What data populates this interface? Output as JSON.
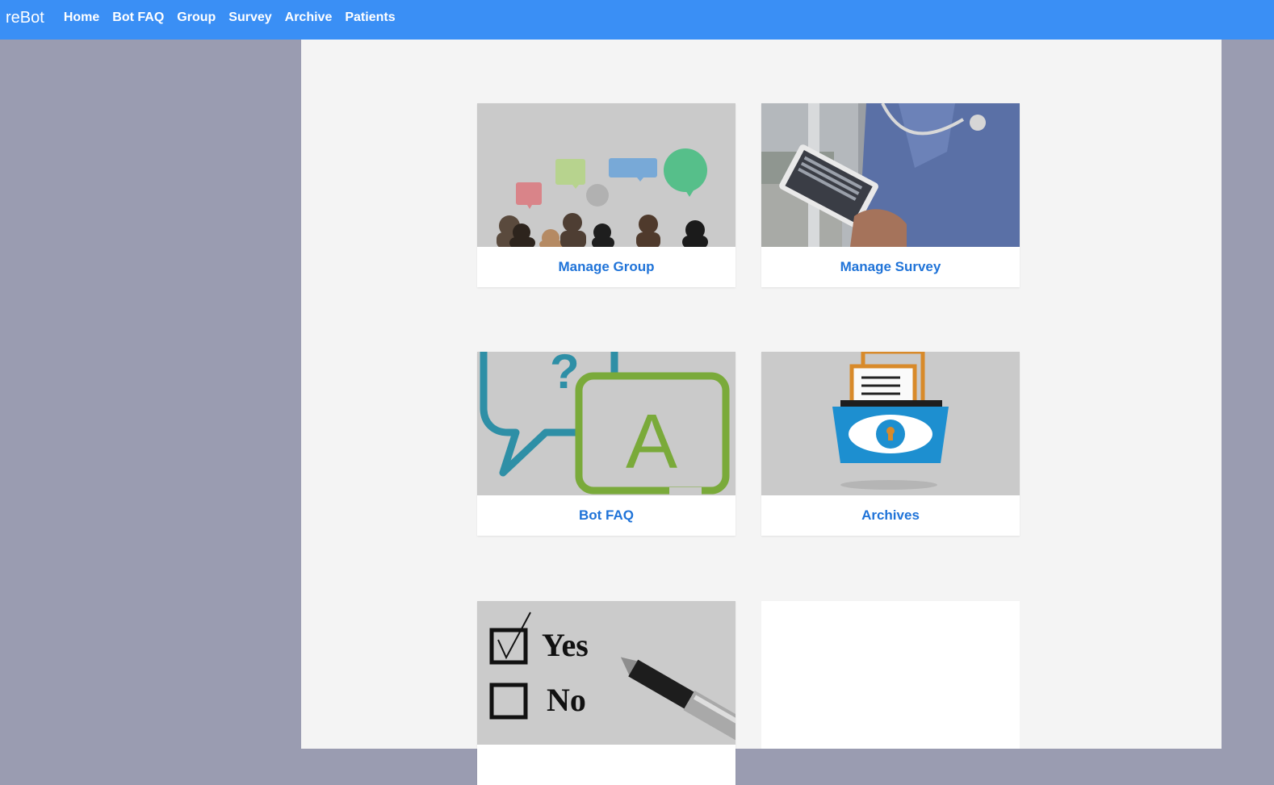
{
  "app": {
    "brand": "reBot"
  },
  "nav": {
    "items": [
      "Home",
      "Bot FAQ",
      "Group",
      "Survey",
      "Archive",
      "Patients"
    ]
  },
  "cards": [
    {
      "label": "Manage Group",
      "image": "group-chat-illustration"
    },
    {
      "label": "Manage Survey",
      "image": "doctor-tablet-photo"
    },
    {
      "label": "Bot FAQ",
      "image": "question-answer-bubbles"
    },
    {
      "label": "Archives",
      "image": "archive-folder-eye"
    },
    {
      "label": "",
      "image": "checkbox-yes-no-pen",
      "checkbox_options": [
        "Yes",
        "No"
      ]
    }
  ]
}
